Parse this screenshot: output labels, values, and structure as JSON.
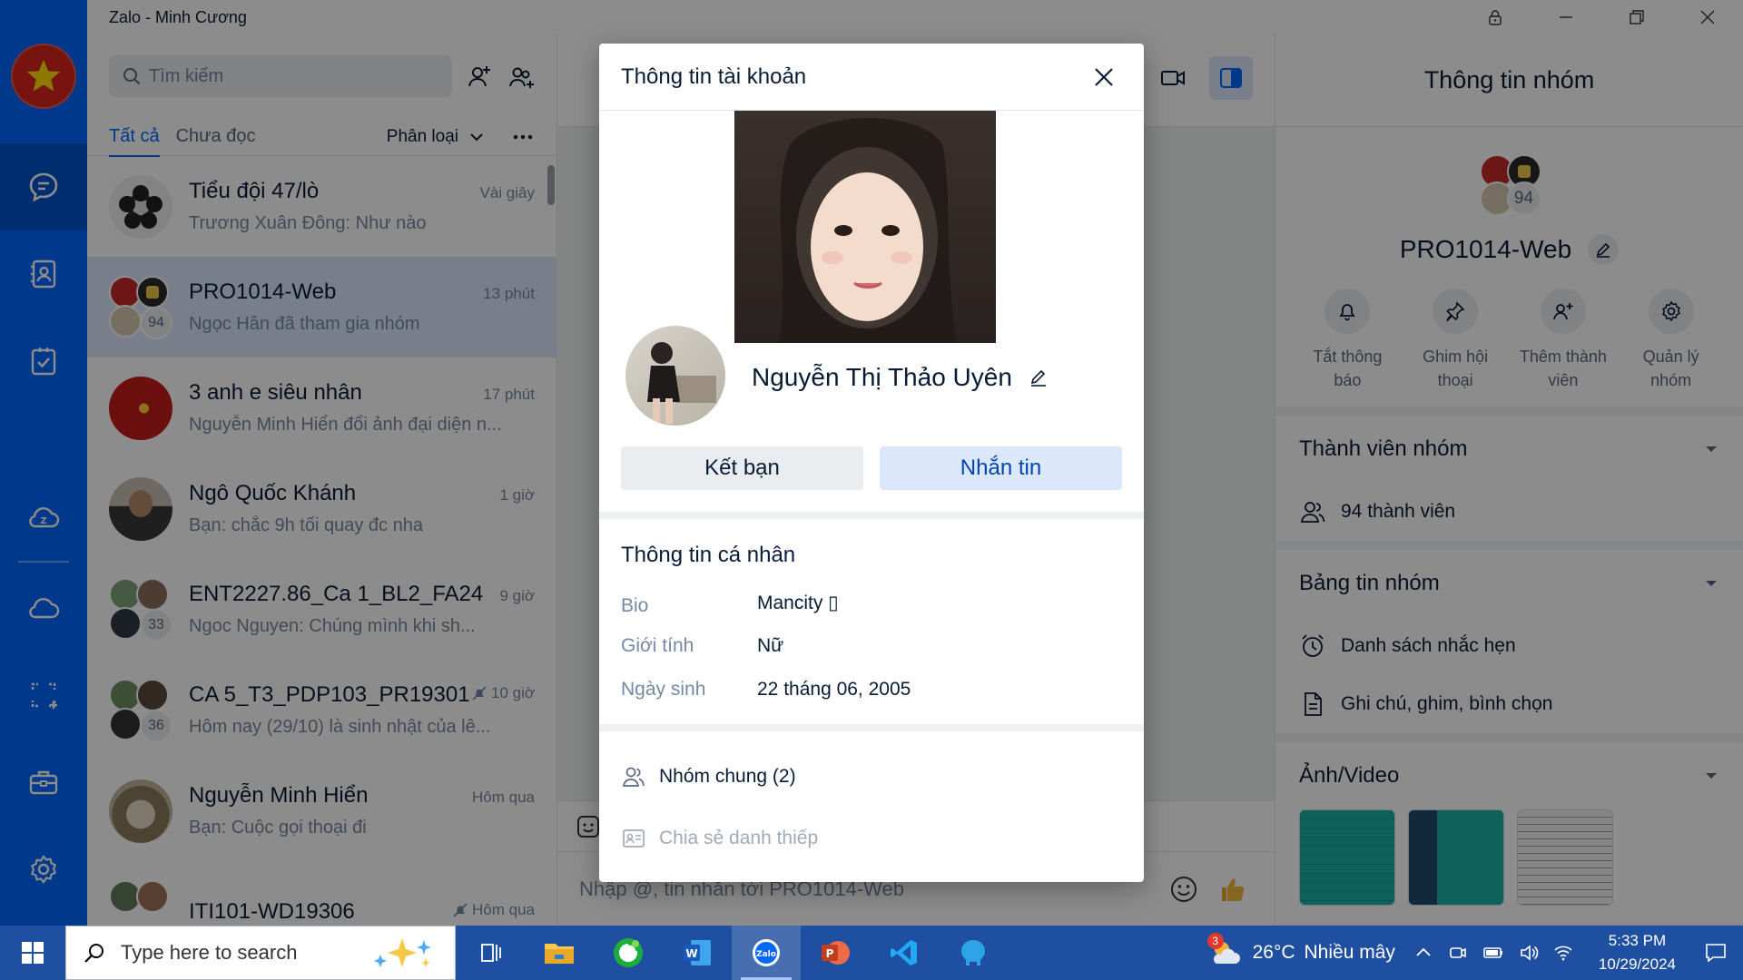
{
  "window": {
    "title": "Zalo - Minh Cương"
  },
  "sidebar": {
    "items": [
      "messages-icon",
      "contacts-icon",
      "todo-icon",
      "zcloud-icon",
      "cloud-icon",
      "screenshot-icon",
      "toolbox-icon",
      "settings-icon"
    ]
  },
  "conversation_list": {
    "search_placeholder": "Tìm kiếm",
    "tabs": [
      {
        "label": "Tất cả",
        "active": true
      },
      {
        "label": "Chưa đọc",
        "active": false
      }
    ],
    "classify_label": "Phân loại",
    "items": [
      {
        "name": "Tiểu đội 47/lò",
        "time": "Vài giây",
        "preview": "Trương Xuân Đông: Như nào"
      },
      {
        "name": "PRO1014-Web",
        "time": "13 phút",
        "preview": "Ngọc Hân đã tham gia nhóm",
        "member_count": "94"
      },
      {
        "name": "3 anh e siêu nhân",
        "time": "17 phút",
        "preview": "Nguyễn Minh Hiển đổi ảnh đại diện n..."
      },
      {
        "name": "Ngô Quốc Khánh",
        "time": "1 giờ",
        "preview": "Bạn: chắc 9h tối quay đc nha"
      },
      {
        "name": "ENT2227.86_Ca 1_BL2_FA24",
        "time": "9 giờ",
        "preview": "Ngoc Nguyen: Chúng mình khi sh...",
        "member_count": "33"
      },
      {
        "name": "CA 5_T3_PDP103_PR19301",
        "time": "10 giờ",
        "preview": "Hôm nay (29/10) là sinh nhật của lê...",
        "member_count": "36"
      },
      {
        "name": "Nguyễn Minh Hiển",
        "time": "Hôm qua",
        "preview": "Bạn: Cuộc gọi thoại đi"
      },
      {
        "name": "ITI101-WD19306",
        "time": "Hôm qua",
        "preview": ""
      }
    ]
  },
  "chat": {
    "input_placeholder": "Nhập @, tin nhắn tới PRO1014-Web"
  },
  "group_panel": {
    "title": "Thông tin nhóm",
    "group_name": "PRO1014-Web",
    "member_badge": "94",
    "actions": [
      {
        "label": "Tắt thông báo",
        "icon": "bell-icon"
      },
      {
        "label": "Ghim hội thoại",
        "icon": "pin-icon"
      },
      {
        "label": "Thêm thành viên",
        "icon": "add-member-icon"
      },
      {
        "label": "Quản lý nhóm",
        "icon": "gear-icon"
      }
    ],
    "members_section": {
      "title": "Thành viên nhóm",
      "count_label": "94 thành viên"
    },
    "board_section": {
      "title": "Bảng tin nhóm",
      "reminders": "Danh sách nhắc hẹn",
      "notes": "Ghi chú, ghim, bình chọn"
    },
    "media_section": {
      "title": "Ảnh/Video"
    }
  },
  "modal": {
    "title": "Thông tin tài khoản",
    "name": "Nguyễn Thị Thảo Uyên",
    "add_friend_label": "Kết bạn",
    "message_label": "Nhắn tin",
    "personal_title": "Thông tin cá nhân",
    "fields": [
      {
        "key": "Bio",
        "value": "Mancity ▯"
      },
      {
        "key": "Giới tính",
        "value": "Nữ"
      },
      {
        "key": "Ngày sinh",
        "value": "22 tháng 06, 2005"
      }
    ],
    "common_groups": "Nhóm chung (2)",
    "share_card": "Chia sẻ danh thiếp"
  },
  "taskbar": {
    "search_placeholder": "Type here to search",
    "weather_badge": "3",
    "temperature": "26°C",
    "weather": "Nhiều mây",
    "time": "5:33 PM",
    "date": "10/29/2024"
  },
  "colors": {
    "accent": "#0068ff",
    "nav": "#0068ff",
    "taskbar": "#1f4fa0"
  }
}
